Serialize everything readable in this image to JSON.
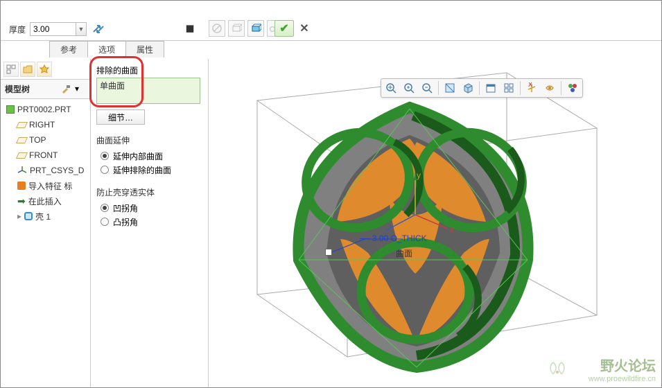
{
  "toolbar": {
    "thickness_label": "厚度",
    "thickness_value": "3.00"
  },
  "tabs": {
    "ref": "参考",
    "options": "选项",
    "properties": "属性"
  },
  "tree": {
    "header": "模型树",
    "part": "PRT0002.PRT",
    "right": "RIGHT",
    "top": "TOP",
    "front": "FRONT",
    "csys": "PRT_CSYS_D",
    "import": "导入特征 标",
    "insert_here": "在此插入",
    "shell": "壳 1"
  },
  "options": {
    "excluded_label": "排除的曲面",
    "single_surface": "单曲面",
    "detail_btn": "细节…",
    "extend_title": "曲面延伸",
    "extend_internal": "延伸内部曲面",
    "extend_excluded": "延伸排除的曲面",
    "prevent_title": "防止壳穿透实体",
    "concave": "凹拐角",
    "convex": "凸拐角"
  },
  "viewport": {
    "dim_text": "3.00 O_THICK",
    "surf_label": "曲面"
  },
  "watermark": {
    "main": "野火论坛",
    "sub": "www.proewildfire.cn"
  },
  "icons": {
    "flip": "⤢",
    "check": "✔",
    "x": "✕"
  }
}
